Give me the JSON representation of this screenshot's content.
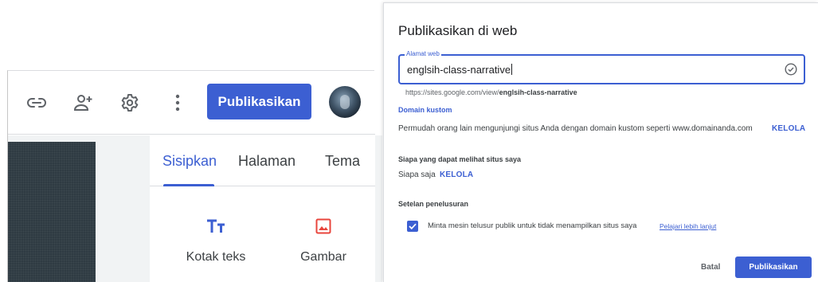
{
  "editor": {
    "toolbar": {
      "icons": [
        "link-icon",
        "add-person-icon",
        "gear-icon",
        "more-vert-icon"
      ],
      "publish_label": "Publikasikan"
    },
    "side_panel": {
      "tabs": [
        {
          "label": "Sisipkan",
          "active": true
        },
        {
          "label": "Halaman",
          "active": false
        },
        {
          "label": "Tema",
          "active": false
        }
      ],
      "tiles": [
        {
          "label": "Kotak teks",
          "icon": "text-box-icon"
        },
        {
          "label": "Gambar",
          "icon": "image-icon"
        }
      ]
    }
  },
  "dialog": {
    "title": "Publikasikan di web",
    "url_field": {
      "legend": "Alamat web",
      "value": "englsih-class-narrative"
    },
    "url_preview": {
      "prefix": "https://sites.google.com/view/",
      "slug": "englsih-class-narrative"
    },
    "custom_domain": {
      "heading": "Domain kustom",
      "text": "Permudah orang lain mengunjungi situs Anda dengan domain kustom seperti www.domainanda.com",
      "action": "KELOLA"
    },
    "visibility": {
      "heading": "Siapa yang dapat melihat situs saya",
      "value": "Siapa saja",
      "action": "KELOLA"
    },
    "search": {
      "heading": "Setelan penelusuran",
      "checkbox_label": "Minta mesin telusur publik untuk tidak menampilkan situs saya",
      "checked": true,
      "learn_more": "Pelajari lebih lanjut"
    },
    "buttons": {
      "cancel": "Batal",
      "publish": "Publikasikan"
    }
  },
  "colors": {
    "accent": "#3c5fd2",
    "text": "#202124",
    "muted": "#5f6368",
    "divider": "#dadce0"
  }
}
